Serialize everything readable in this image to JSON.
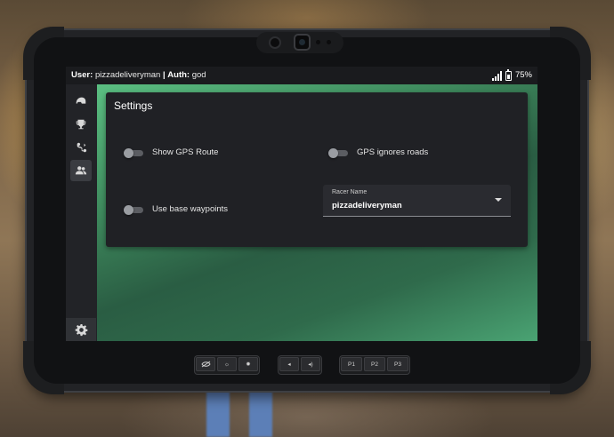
{
  "status": {
    "user_label": "User:",
    "user_value": "pizzadeliveryman",
    "separator": "|",
    "auth_label": "Auth:",
    "auth_value": "god",
    "battery": "75%"
  },
  "sidebar": {
    "items": [
      {
        "icon": "helmet-icon"
      },
      {
        "icon": "trophy-icon"
      },
      {
        "icon": "route-icon"
      },
      {
        "icon": "users-icon",
        "active": true
      }
    ],
    "bottom": {
      "icon": "gear-icon"
    }
  },
  "settings": {
    "title": "Settings",
    "show_gps_route": {
      "label": "Show GPS Route",
      "on": false
    },
    "gps_ignores_roads": {
      "label": "GPS ignores roads",
      "on": false
    },
    "use_base_waypoints": {
      "label": "Use base waypoints",
      "on": false
    },
    "racer_name": {
      "label": "Racer Name",
      "value": "pizzadeliveryman"
    }
  },
  "hardware": {
    "group1": [
      {
        "icon": "eye-off-icon"
      },
      {
        "icon": "brightness-low-icon"
      },
      {
        "icon": "brightness-high-icon"
      }
    ],
    "group2": [
      {
        "icon": "volume-down-icon"
      },
      {
        "icon": "volume-up-icon"
      }
    ],
    "group3": [
      "P1",
      "P2",
      "P3"
    ]
  }
}
